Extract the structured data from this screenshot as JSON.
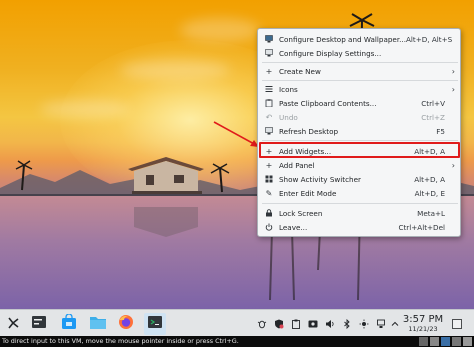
{
  "context_menu": {
    "items": [
      {
        "label": "Configure Desktop and Wallpaper...",
        "shortcut": "Alt+D, Alt+S",
        "icon": "desktop-settings-icon"
      },
      {
        "label": "Configure Display Settings...",
        "shortcut": "",
        "icon": "display-icon"
      },
      {
        "label": "Create New",
        "shortcut": "",
        "icon": "plus-icon",
        "submenu": true
      },
      {
        "label": "Icons",
        "shortcut": "",
        "icon": "list-icon",
        "submenu": true
      },
      {
        "label": "Paste Clipboard Contents...",
        "shortcut": "Ctrl+V",
        "icon": "paste-icon"
      },
      {
        "label": "Undo",
        "shortcut": "Ctrl+Z",
        "icon": "undo-icon",
        "disabled": true
      },
      {
        "label": "Refresh Desktop",
        "shortcut": "F5",
        "icon": "refresh-icon"
      },
      {
        "label": "Add Widgets...",
        "shortcut": "Alt+D, A",
        "icon": "plus-icon",
        "highlighted": true
      },
      {
        "label": "Add Panel",
        "shortcut": "",
        "icon": "plus-icon",
        "submenu": true
      },
      {
        "label": "Show Activity Switcher",
        "shortcut": "Alt+D, A",
        "icon": "activity-icon"
      },
      {
        "label": "Enter Edit Mode",
        "shortcut": "Alt+D, E",
        "icon": "edit-icon"
      },
      {
        "label": "Lock Screen",
        "shortcut": "Meta+L",
        "icon": "lock-icon"
      },
      {
        "label": "Leave...",
        "shortcut": "Ctrl+Alt+Del",
        "icon": "power-icon"
      }
    ]
  },
  "taskbar": {
    "apps": [
      {
        "name": "application-launcher",
        "icon": "kde-launcher-icon"
      },
      {
        "name": "system-settings",
        "icon": "settings-icon"
      },
      {
        "name": "discover",
        "icon": "store-icon"
      },
      {
        "name": "file-manager",
        "icon": "folder-icon"
      },
      {
        "name": "firefox",
        "icon": "firefox-icon"
      },
      {
        "name": "konsole",
        "icon": "terminal-icon"
      }
    ],
    "clock": {
      "time": "3:57 PM",
      "date": "11/21/23"
    }
  },
  "statusbar": {
    "message": "To direct input to this VM, move the mouse pointer inside or press Ctrl+G."
  },
  "colors": {
    "highlight_border": "#e01b1b",
    "arrow": "#e01b1b",
    "menu_bg": "#f5f6f7"
  }
}
